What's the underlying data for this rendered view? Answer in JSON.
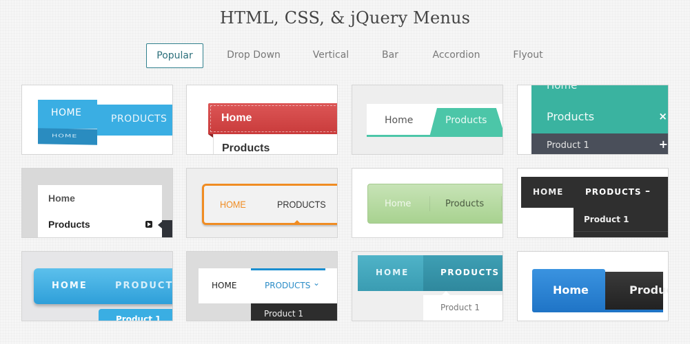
{
  "page": {
    "title": "HTML, CSS, & jQuery Menus"
  },
  "tabs": [
    {
      "label": "Popular",
      "active": true
    },
    {
      "label": "Drop Down",
      "active": false
    },
    {
      "label": "Vertical",
      "active": false
    },
    {
      "label": "Bar",
      "active": false
    },
    {
      "label": "Accordion",
      "active": false
    },
    {
      "label": "Flyout",
      "active": false
    }
  ],
  "colors": {
    "tab_active_border": "#2f7f8c",
    "blue_3d": "#3aaee3",
    "red_ribbon": "#d74b4b",
    "teal_tab": "#4cc6a8",
    "teal_accordion": "#3ab3a0",
    "slate": "#4a4f5a",
    "orange": "#f08c22",
    "green": "#b5d9a0",
    "dark": "#2f2f2f",
    "blue_button": "#2f98d8",
    "teal_bar": "#3aa3b8",
    "blue_home": "#2c85d6"
  },
  "cards": [
    {
      "items": [
        "HOME",
        "PRODUCTS"
      ],
      "flip_label": "HOME"
    },
    {
      "items": [
        "Home",
        "Products"
      ]
    },
    {
      "items": [
        "Home",
        "Products"
      ]
    },
    {
      "items": [
        "Home",
        "Products"
      ],
      "sub_item": "Product 1",
      "close_icon": "×",
      "expand_icon": "+"
    },
    {
      "items": [
        "Home",
        "Products"
      ]
    },
    {
      "items": [
        "HOME",
        "PRODUCTS"
      ]
    },
    {
      "items": [
        "Home",
        "Products"
      ]
    },
    {
      "items": [
        "HOME",
        "PRODUCTS"
      ],
      "toggle_icon": "–",
      "sub_item": "Product 1"
    },
    {
      "items": [
        "HOME",
        "PRODUCTS"
      ],
      "sub_item": "Product 1"
    },
    {
      "items": [
        "HOME",
        "PRODUCTS"
      ],
      "chevron": "⌄",
      "sub_item": "Product 1"
    },
    {
      "items": [
        "HOME",
        "PRODUCTS"
      ],
      "sub_item": "Product 1"
    },
    {
      "items": [
        "Home",
        "Produc"
      ]
    }
  ]
}
